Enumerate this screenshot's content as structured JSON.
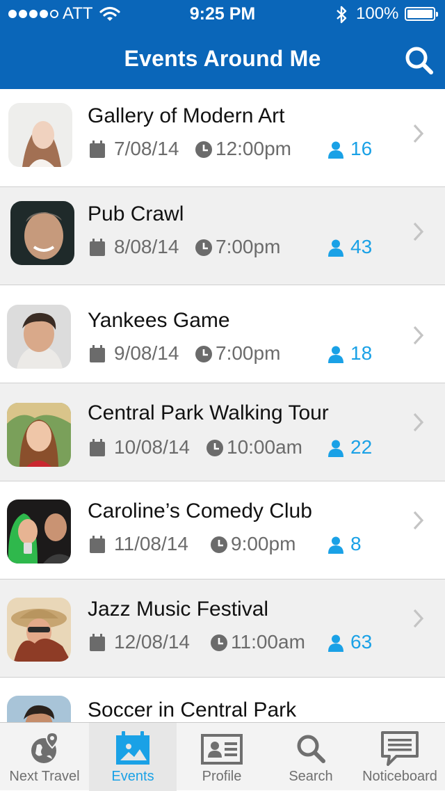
{
  "status_bar": {
    "carrier": "ATT",
    "time": "9:25 PM",
    "battery": "100%"
  },
  "nav": {
    "title": "Events Around Me",
    "search_icon": "search-icon"
  },
  "colors": {
    "brand": "#0a66b9",
    "accent": "#1aa1e6",
    "meta_text": "#6b6b6b"
  },
  "events": [
    {
      "title": "Gallery of Modern Art",
      "date": "7/08/14",
      "time": "12:00pm",
      "attendees": "16"
    },
    {
      "title": "Pub Crawl",
      "date": "8/08/14",
      "time": "7:00pm",
      "attendees": "43"
    },
    {
      "title": "Yankees Game",
      "date": "9/08/14",
      "time": "7:00pm",
      "attendees": "18"
    },
    {
      "title": "Central Park Walking Tour",
      "date": "10/08/14",
      "time": "10:00am",
      "attendees": "22"
    },
    {
      "title": "Caroline’s Comedy Club",
      "date": "11/08/14",
      "time": "9:00pm",
      "attendees": "8"
    },
    {
      "title": "Jazz Music Festival",
      "date": "12/08/14",
      "time": "11:00am",
      "attendees": "63"
    },
    {
      "title": "Soccer in Central Park"
    }
  ],
  "tabs": [
    {
      "label": "Next Travel",
      "icon": "globe-pin-icon"
    },
    {
      "label": "Events",
      "icon": "calendar-image-icon",
      "active": true
    },
    {
      "label": "Profile",
      "icon": "id-card-icon"
    },
    {
      "label": "Search",
      "icon": "search-icon"
    },
    {
      "label": "Noticeboard",
      "icon": "speech-bubble-icon"
    }
  ]
}
